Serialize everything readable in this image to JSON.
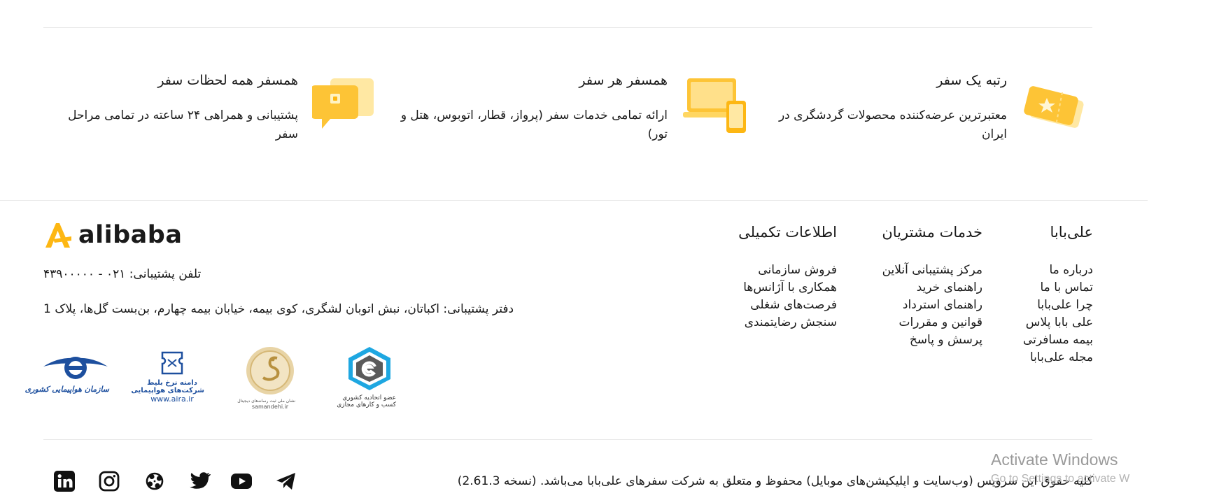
{
  "features": [
    {
      "title": "رتبه یک سفر",
      "desc": "معتبرترین عرضه‌کننده محصولات گردشگری در ایران",
      "icon": "ticket-star-icon"
    },
    {
      "title": "همسفر هر سفر",
      "desc": "ارائه تمامی خدمات سفر (پرواز، قطار، اتوبوس، هتل و تور)",
      "icon": "laptop-phone-icon"
    },
    {
      "title": "همسفر همه لحظات سفر",
      "desc": "پشتیبانی و همراهی ۲۴ ساعته در تمامی مراحل سفر",
      "icon": "chat-support-icon"
    }
  ],
  "footer": {
    "columns": [
      {
        "title": "علی‌بابا",
        "links": [
          "درباره ما",
          "تماس با ما",
          "چرا علی‌بابا",
          "علی بابا پلاس",
          "بیمه مسافرتی",
          "مجله علی‌بابا"
        ]
      },
      {
        "title": "خدمات مشتریان",
        "links": [
          "مرکز پشتیبانی آنلاین",
          "راهنمای خرید",
          "راهنمای استرداد",
          "قوانین و مقررات",
          "پرسش و پاسخ"
        ]
      },
      {
        "title": "اطلاعات تکمیلی",
        "links": [
          "فروش سازمانی",
          "همکاری با آژانس‌ها",
          "فرصت‌های شغلی",
          "سنجش رضایتمندی"
        ]
      }
    ],
    "brand": {
      "logo_text": "alibaba",
      "accent": "#fdb713"
    },
    "support_phone": "تلفن پشتیبانی: ۰۲۱ - ۴۳۹۰۰۰۰۰",
    "support_office": "دفتر پشتیبانی: اکباتان، نبش اتوبان لشگری، کوی بیمه، خیابان بیمه چهارم، بن‌بست گل‌ها، پلاک 1",
    "badges": {
      "enamad": {
        "line1": "عضو اتحادیه کشوری",
        "line2": "کسب و کارهای مجازی"
      },
      "samandehi": {
        "caption": "samandehi.ir",
        "subcaption": "نشان ملی ثبت رسانه‌های دیجیتال"
      },
      "aira": {
        "line1": "دامنه نرخ بلیط",
        "line2": "شرکت‌های هواپیمایی",
        "url": "www.aira.ir"
      },
      "cao": {
        "caption": "سازمان هواپیمایی کشوری"
      }
    },
    "copyright": "کلیه حقوق این سرویس (وب‌سایت و اپلیکیشن‌های موبایل) محفوظ و متعلق به شرکت سفرهای علی‌بابا می‌باشد. (نسخه 2.61.3)",
    "socials": [
      "linkedin-icon",
      "instagram-icon",
      "aparat-icon",
      "twitter-icon",
      "youtube-icon",
      "telegram-icon"
    ]
  },
  "watermark": {
    "title": "Activate Windows",
    "subtitle": "Go to Settings to activate W"
  }
}
